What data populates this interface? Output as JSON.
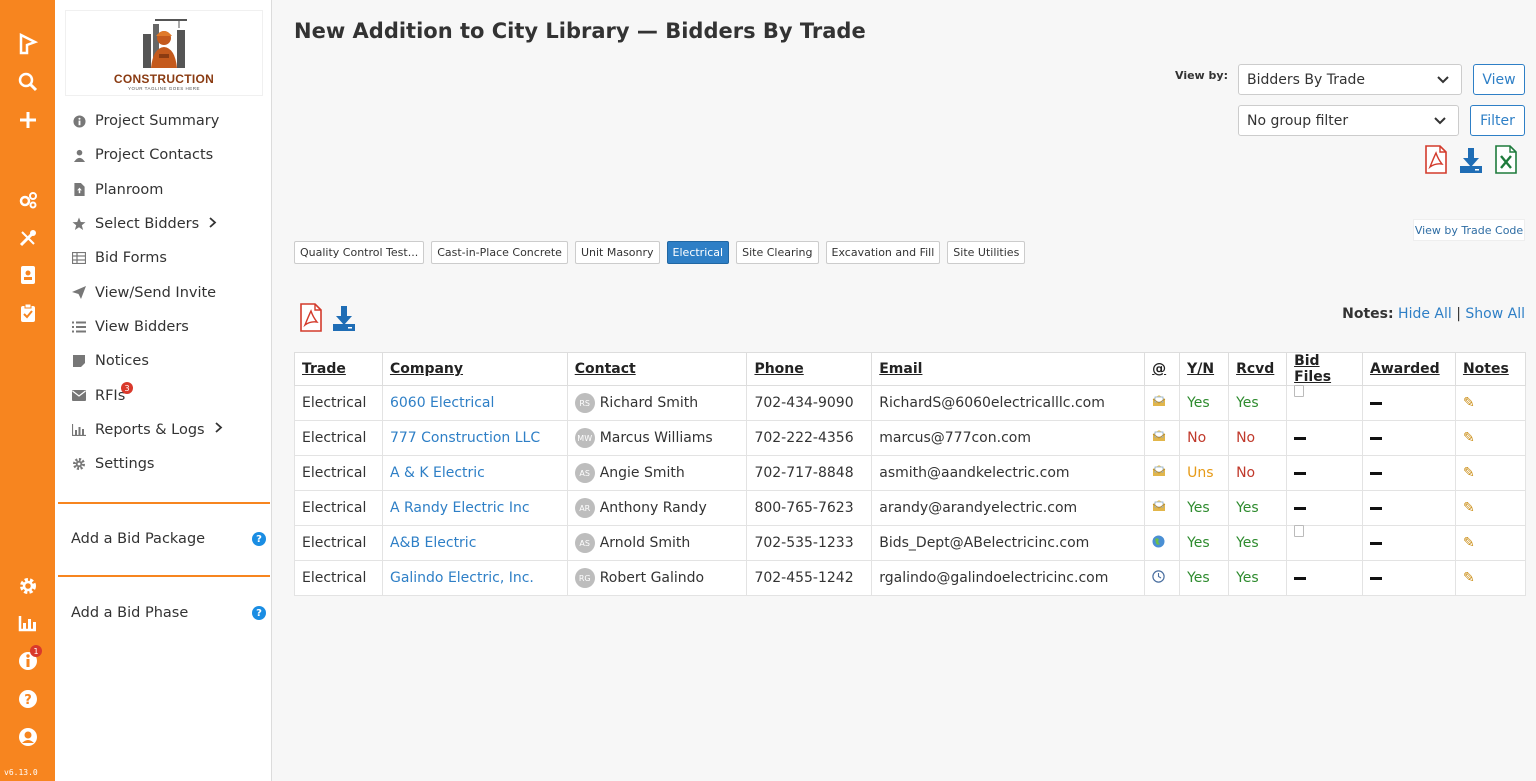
{
  "rail": {
    "icons": [
      "app-logo-icon",
      "search-icon",
      "plus-icon",
      "settings-group-icon",
      "tools-icon",
      "contact-book-icon",
      "clipboard-check-icon",
      "gear-icon",
      "bar-chart-icon",
      "info-icon",
      "help-icon",
      "user-icon"
    ],
    "info_badge": "1",
    "version": "v6.13.0"
  },
  "logo": {
    "brand": "CONSTRUCTION",
    "tagline": "YOUR TAGLINE GOES HERE"
  },
  "sidebar": {
    "items": [
      {
        "label": "Project Summary",
        "icon": "info-circle-icon"
      },
      {
        "label": "Project Contacts",
        "icon": "person-icon"
      },
      {
        "label": "Planroom",
        "icon": "file-upload-icon"
      },
      {
        "label": "Select Bidders",
        "icon": "star-icon"
      },
      {
        "label": "Bid Forms",
        "icon": "table-icon"
      },
      {
        "label": "View/Send Invite",
        "icon": "paper-plane-icon"
      },
      {
        "label": "View Bidders",
        "icon": "list-icon"
      },
      {
        "label": "Notices",
        "icon": "note-icon"
      },
      {
        "label": "RFIs",
        "icon": "envelope-icon",
        "badge": "3"
      },
      {
        "label": "Reports & Logs",
        "icon": "line-chart-icon"
      },
      {
        "label": "Settings",
        "icon": "cog-icon"
      }
    ],
    "add_bid_package": "Add a Bid Package",
    "add_bid_phase": "Add a Bid Phase",
    "help_glyph": "?"
  },
  "header": {
    "title": "New Addition to City Library — Bidders By Trade",
    "view_by_label": "View by:",
    "view_by_value": "Bidders By Trade",
    "view_button": "View",
    "group_filter_value": "No group filter",
    "filter_button": "Filter",
    "view_by_trade_code": "View by Trade Code"
  },
  "tabs": [
    {
      "label": "Quality Control Test...",
      "active": false
    },
    {
      "label": "Cast-in-Place Concrete",
      "active": false
    },
    {
      "label": "Unit Masonry",
      "active": false
    },
    {
      "label": "Electrical",
      "active": true
    },
    {
      "label": "Site Clearing",
      "active": false
    },
    {
      "label": "Excavation and Fill",
      "active": false
    },
    {
      "label": "Site Utilities",
      "active": false
    }
  ],
  "notes_controls": {
    "label": "Notes:",
    "hide_all": "Hide All",
    "separator": "|",
    "show_all": "Show All"
  },
  "table": {
    "columns": [
      "Trade",
      "Company",
      "Contact",
      "Phone",
      "Email",
      "@",
      "Y/N",
      "Rcvd",
      "Bid Files",
      "Awarded",
      "Notes"
    ],
    "rows": [
      {
        "trade": "Electrical",
        "company": "6060 Electrical",
        "initials": "RS",
        "contact": "Richard Smith",
        "phone": "702-434-9090",
        "email": "RichardS@6060electricalllc.com",
        "at_icon": "email-opened-icon",
        "yn": "Yes",
        "rcvd": "Yes",
        "bid_files": "file",
        "awarded": "dash"
      },
      {
        "trade": "Electrical",
        "company": "777 Construction LLC",
        "initials": "MW",
        "contact": "Marcus Williams",
        "phone": "702-222-4356",
        "email": "marcus@777con.com",
        "at_icon": "email-opened-icon",
        "yn": "No",
        "rcvd": "No",
        "bid_files": "dash",
        "awarded": "dash"
      },
      {
        "trade": "Electrical",
        "company": "A & K Electric",
        "initials": "AS",
        "contact": "Angie Smith",
        "phone": "702-717-8848",
        "email": "asmith@aandkelectric.com",
        "at_icon": "email-opened-icon",
        "yn": "Uns",
        "rcvd": "No",
        "bid_files": "dash",
        "awarded": "dash"
      },
      {
        "trade": "Electrical",
        "company": "A Randy Electric Inc",
        "initials": "AR",
        "contact": "Anthony Randy",
        "phone": "800-765-7623",
        "email": "arandy@arandyelectric.com",
        "at_icon": "email-opened-icon",
        "yn": "Yes",
        "rcvd": "Yes",
        "bid_files": "dash",
        "awarded": "dash"
      },
      {
        "trade": "Electrical",
        "company": "A&B Electric",
        "initials": "AS",
        "contact": "Arnold Smith",
        "phone": "702-535-1233",
        "email": "Bids_Dept@ABelectricinc.com",
        "at_icon": "globe-icon",
        "yn": "Yes",
        "rcvd": "Yes",
        "bid_files": "file",
        "awarded": "dash"
      },
      {
        "trade": "Electrical",
        "company": "Galindo Electric, Inc.",
        "initials": "RG",
        "contact": "Robert Galindo",
        "phone": "702-455-1242",
        "email": "rgalindo@galindoelectricinc.com",
        "at_icon": "clock-icon",
        "yn": "Yes",
        "rcvd": "Yes",
        "bid_files": "dash",
        "awarded": "dash"
      }
    ]
  },
  "colors": {
    "rail": "#f7851f",
    "link": "#2e7fc6",
    "yes": "#2e8b2e",
    "no": "#c0392b",
    "uns": "#e69a17"
  }
}
